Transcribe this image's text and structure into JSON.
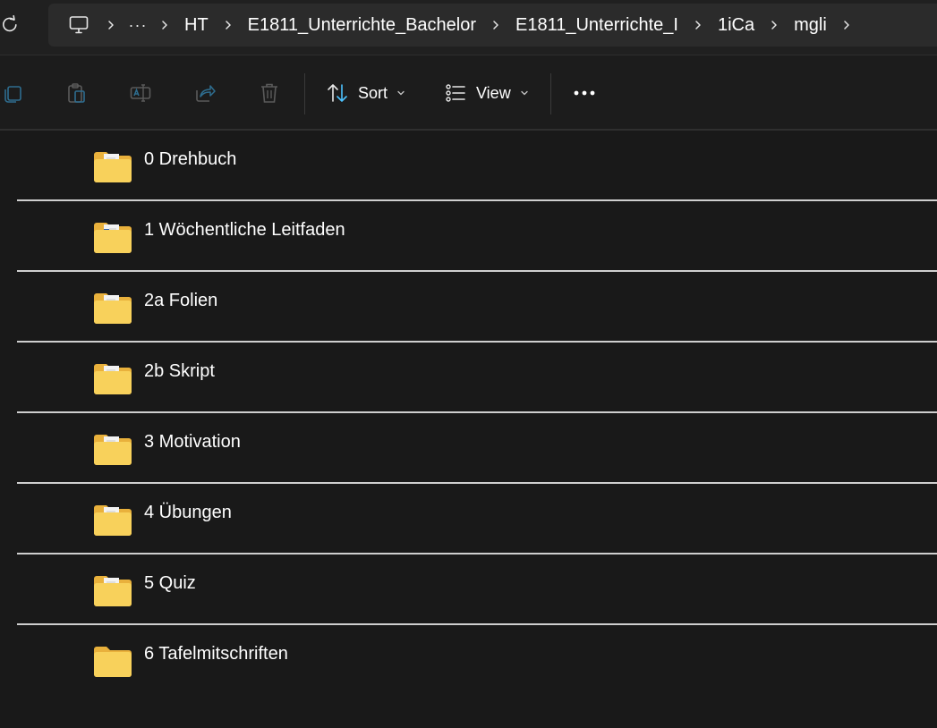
{
  "addressbar": {
    "refresh_icon": "refresh-icon",
    "pc_icon": "this-pc-icon",
    "overflow": "···",
    "breadcrumbs": [
      "HT",
      "E1811_Unterrichte_Bachelor",
      "E1811_Unterrichte_I",
      "1iCa",
      "mgli"
    ]
  },
  "commandbar": {
    "icons": [
      "copy-icon",
      "paste-icon",
      "rename-icon",
      "share-icon",
      "delete-icon"
    ],
    "sort_label": "Sort",
    "view_label": "View",
    "more_icon": "more-icon"
  },
  "files": [
    {
      "name": "0 Drehbuch",
      "icon": "folder-with-pdf"
    },
    {
      "name": "1 Wöchentliche Leitfaden",
      "icon": "folder-with-word"
    },
    {
      "name": "2a Folien",
      "icon": "folder-with-pdf"
    },
    {
      "name": "2b Skript",
      "icon": "folder-with-pdf"
    },
    {
      "name": "3 Motivation",
      "icon": "folder-with-pdf"
    },
    {
      "name": "4 Übungen",
      "icon": "folder-with-pdf"
    },
    {
      "name": "5 Quiz",
      "icon": "folder-with-pdf"
    },
    {
      "name": "6 Tafelmitschriften",
      "icon": "folder-empty"
    }
  ],
  "colors": {
    "background": "#191919",
    "folder_yellow": "#f8d15b",
    "divider": "#cfcfcf",
    "accent_blue": "#4cc2ff"
  }
}
